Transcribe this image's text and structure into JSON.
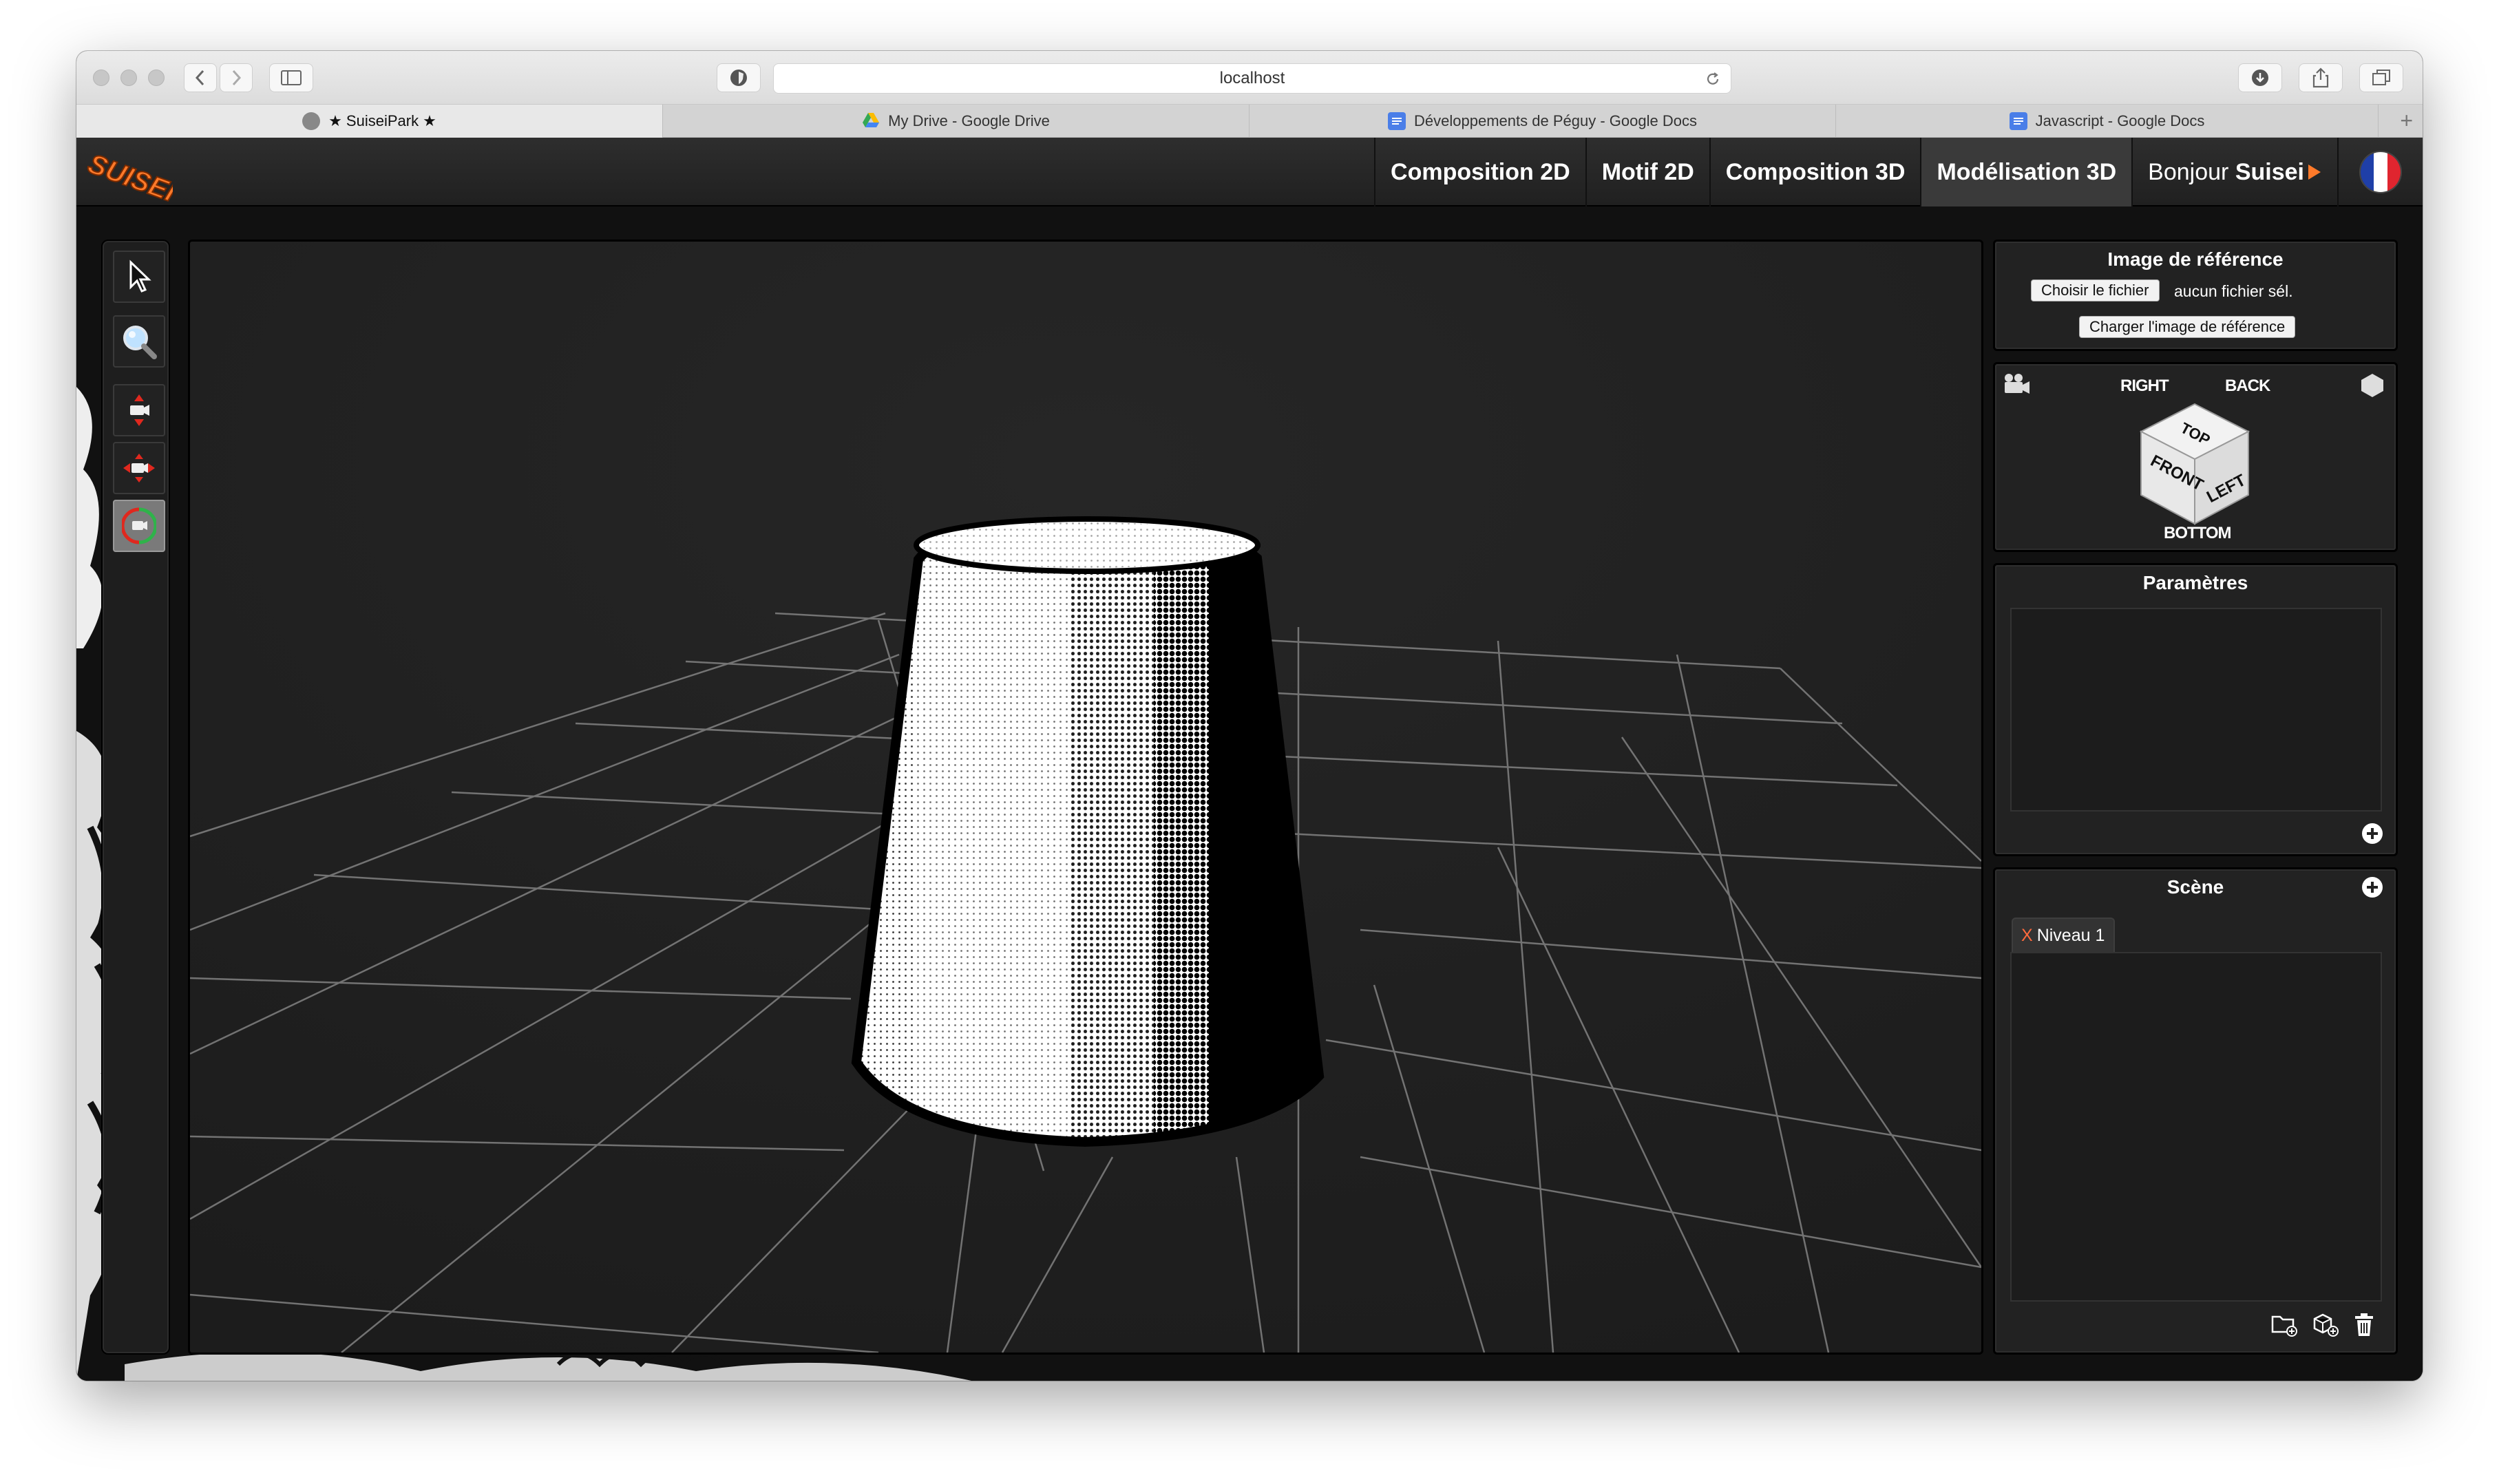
{
  "browser": {
    "url": "localhost",
    "tabs": [
      {
        "label": "★ SuiseiPark ★",
        "active": true
      },
      {
        "label": "My Drive - Google Drive",
        "active": false
      },
      {
        "label": "Développements de Péguy - Google Docs",
        "active": false
      },
      {
        "label": "Javascript - Google Docs",
        "active": false
      }
    ],
    "new_tab": "+"
  },
  "app": {
    "logo_text": "SUISEI",
    "nav": [
      {
        "label": "Composition 2D",
        "active": false
      },
      {
        "label": "Motif 2D",
        "active": false
      },
      {
        "label": "Composition 3D",
        "active": false
      },
      {
        "label": "Modélisation 3D",
        "active": true
      }
    ],
    "greeting": "Bonjour",
    "username": "Suisei",
    "language_flag": "fr"
  },
  "tools": [
    {
      "name": "select",
      "icon": "arrow-pointer-icon",
      "active": false
    },
    {
      "name": "zoom",
      "icon": "magnifier-icon",
      "active": false
    },
    {
      "name": "pan-vertical",
      "icon": "camera-move-icon",
      "active": false
    },
    {
      "name": "pan-horizontal",
      "icon": "camera-pan-icon",
      "active": false
    },
    {
      "name": "orbit",
      "icon": "camera-orbit-icon",
      "active": true
    }
  ],
  "reference_panel": {
    "title": "Image de référence",
    "choose_file": "Choisir le fichier",
    "no_file": "aucun fichier sél.",
    "load_button": "Charger l'image de référence"
  },
  "view_cube": {
    "right": "RIGHT",
    "back": "BACK",
    "top": "TOP",
    "front": "FRONT",
    "left": "LEFT",
    "bottom": "BOTTOM"
  },
  "params_panel": {
    "title": "Paramètres"
  },
  "scene_panel": {
    "title": "Scène",
    "layers": [
      {
        "close": "X",
        "label": "Niveau 1"
      }
    ]
  },
  "colors": {
    "app_bg": "#1a1a1a",
    "panel_bg": "#222222",
    "accent_orange": "#ff7a2a",
    "grid_line": "#9a9a9a"
  }
}
